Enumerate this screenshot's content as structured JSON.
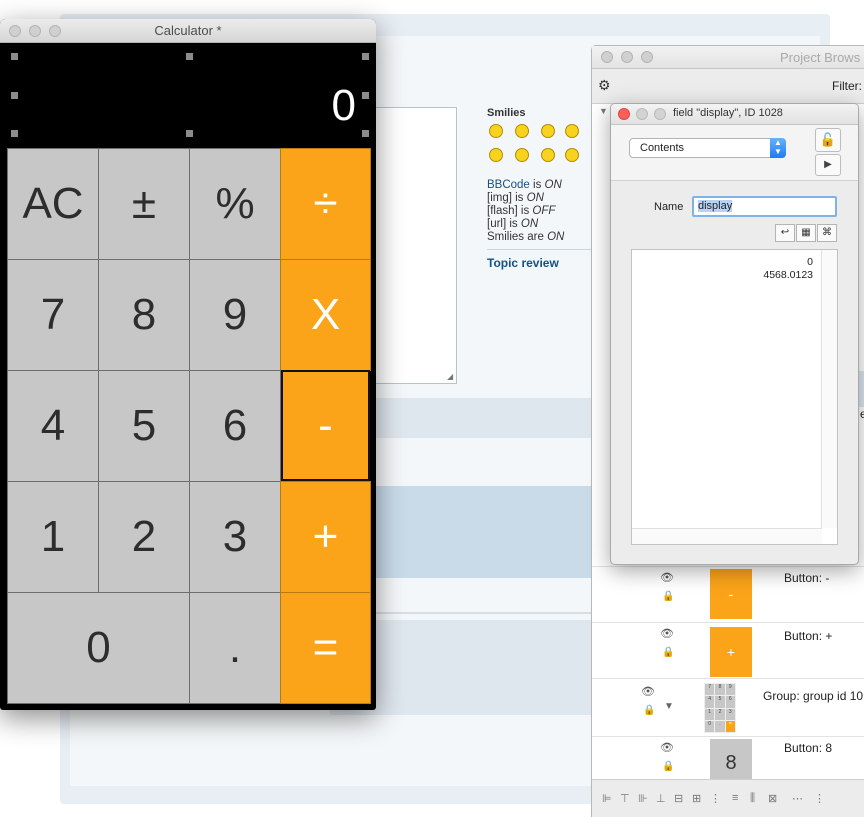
{
  "background": {
    "smilies_title": "Smilies",
    "bbcode_lines": [
      {
        "pre": "",
        "link": "BBCode",
        "mid": " is ",
        "state": "ON"
      },
      {
        "pre": "[img]",
        "link": "",
        "mid": " is ",
        "state": "ON"
      },
      {
        "pre": "[flash]",
        "link": "",
        "mid": " is ",
        "state": "OFF"
      },
      {
        "pre": "[url]",
        "link": "",
        "mid": " is ",
        "state": "ON"
      },
      {
        "pre": "Smilies",
        "link": "",
        "mid": " are ",
        "state": "ON"
      }
    ],
    "topic_review": "Topic review"
  },
  "calculator": {
    "title": "Calculator *",
    "display": "0",
    "keys": {
      "ac": "AC",
      "plusminus": "±",
      "percent": "%",
      "divide": "÷",
      "seven": "7",
      "eight": "8",
      "nine": "9",
      "multiply": "X",
      "four": "4",
      "five": "5",
      "six": "6",
      "minus": "-",
      "one": "1",
      "two": "2",
      "three": "3",
      "plus": "+",
      "zero": "0",
      "decimal": ".",
      "equals": "="
    },
    "colors": {
      "operator": "#fba41a",
      "digit": "#c7c7c7",
      "display_bg": "#000000"
    }
  },
  "project_browser": {
    "title": "Project Brows",
    "filter_label": "Filter:",
    "rows": [
      {
        "label": "Button:",
        "value": "-",
        "thumb": "-"
      },
      {
        "label": "Button:",
        "value": "+",
        "thumb": "+"
      },
      {
        "label": "Group:",
        "value": "group id 10"
      },
      {
        "label": "Button:",
        "value": "8",
        "thumb": "8"
      }
    ],
    "side_text": "era",
    "group_thumb_digits": [
      "7",
      "8",
      "9",
      "4",
      "5",
      "6",
      "1",
      "2",
      "3",
      "0",
      ".",
      "="
    ]
  },
  "inspector": {
    "title": "field \"display\", ID 1028",
    "section_select": "Contents",
    "name_label": "Name",
    "name_value": "display",
    "contents_lines": [
      "0",
      "4568.0123"
    ]
  }
}
